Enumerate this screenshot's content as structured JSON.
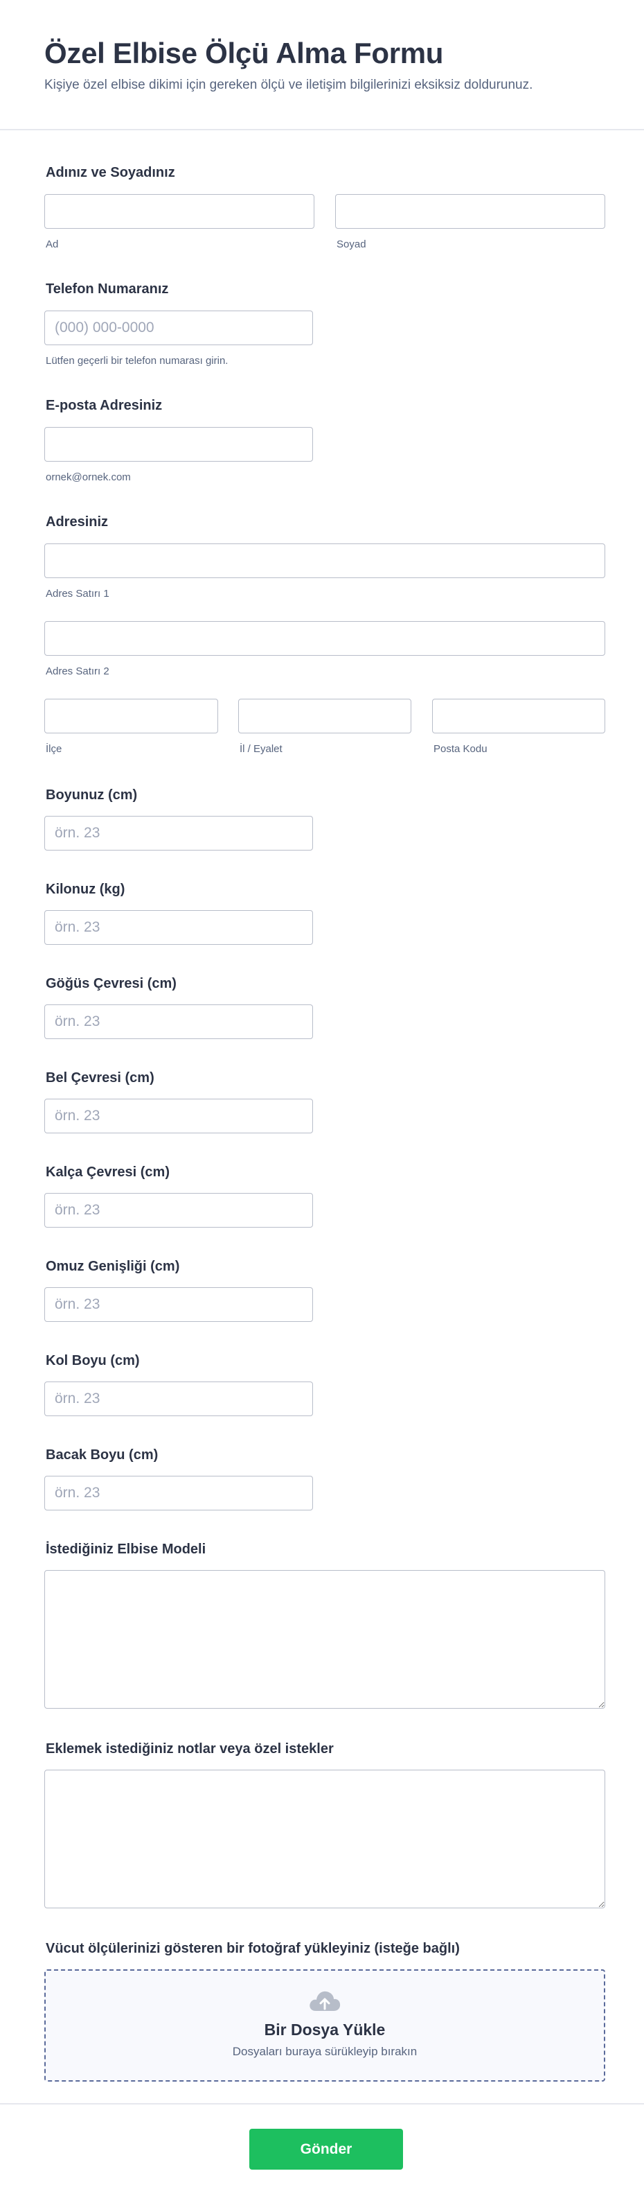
{
  "form": {
    "title": "Özel Elbise Ölçü Alma Formu",
    "subtitle": "Kişiye özel elbise dikimi için gereken ölçü ve iletişim bilgilerinizi eksiksiz doldurunuz."
  },
  "name": {
    "label": "Adınız ve Soyadınız",
    "first_sublabel": "Ad",
    "last_sublabel": "Soyad",
    "first_value": "",
    "last_value": ""
  },
  "phone": {
    "label": "Telefon Numaranız",
    "placeholder": "(000) 000-0000",
    "hint": "Lütfen geçerli bir telefon numarası girin."
  },
  "email": {
    "label": "E-posta Adresiniz",
    "hint": "ornek@ornek.com"
  },
  "address": {
    "label": "Adresiniz",
    "line1_sublabel": "Adres Satırı 1",
    "line2_sublabel": "Adres Satırı 2",
    "district_sublabel": "İlçe",
    "state_sublabel": "İl / Eyalet",
    "postal_sublabel": "Posta Kodu"
  },
  "measurements": {
    "placeholder": "örn. 23",
    "height_label": "Boyunuz (cm)",
    "weight_label": "Kilonuz (kg)",
    "chest_label": "Göğüs Çevresi (cm)",
    "waist_label": "Bel Çevresi (cm)",
    "hip_label": "Kalça Çevresi (cm)",
    "shoulder_label": "Omuz Genişliği (cm)",
    "arm_label": "Kol Boyu (cm)",
    "leg_label": "Bacak Boyu (cm)"
  },
  "model": {
    "label": "İstediğiniz Elbise Modeli"
  },
  "notes": {
    "label": "Eklemek istediğiniz notlar veya özel istekler"
  },
  "upload": {
    "label": "Vücut ölçülerinizi gösteren bir fotoğraf yükleyiniz (isteğe bağlı)",
    "title": "Bir Dosya Yükle",
    "subtitle": "Dosyaları buraya sürükleyip bırakın",
    "icon": "cloud-upload-icon"
  },
  "submit": {
    "label": "Gönder"
  },
  "colors": {
    "accent": "#1dbf5f",
    "text": "#2c3345",
    "muted": "#57647e",
    "border": "#b8bdc9",
    "upload_border": "#5a6a9a"
  }
}
